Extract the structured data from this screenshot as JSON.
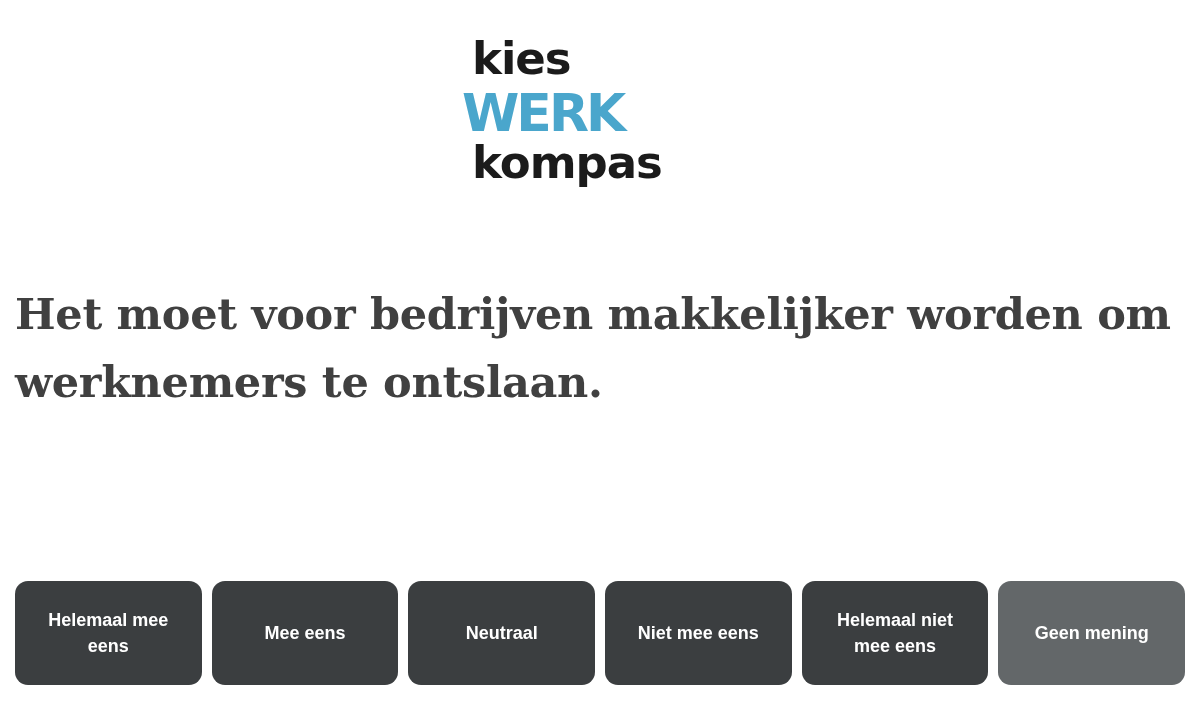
{
  "logo": {
    "lines": [
      {
        "text": "kies",
        "color": "#1b1b1b"
      },
      {
        "text": "WERK",
        "color": "#4aa6cc"
      },
      {
        "text": "kompas",
        "color": "#1b1b1b"
      }
    ]
  },
  "question": "Het moet voor bedrijven makkelijker worden om werknemers te ontslaan.",
  "answers": [
    {
      "label": "Helemaal mee eens",
      "kind": "answer"
    },
    {
      "label": "Mee eens",
      "kind": "answer"
    },
    {
      "label": "Neutraal",
      "kind": "answer"
    },
    {
      "label": "Niet mee eens",
      "kind": "answer"
    },
    {
      "label": "Helemaal niet mee eens",
      "kind": "answer"
    },
    {
      "label": "Geen mening",
      "kind": "skip"
    }
  ]
}
